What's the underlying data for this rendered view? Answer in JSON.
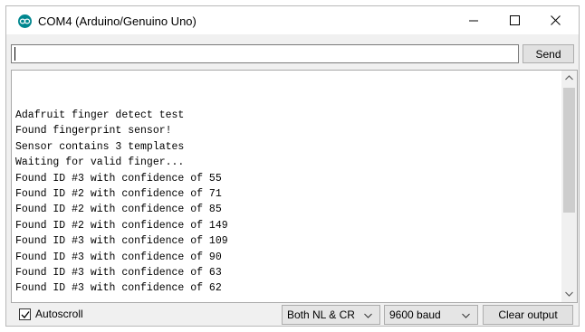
{
  "window": {
    "title": "COM4 (Arduino/Genuino Uno)",
    "icon": "arduino-icon",
    "controls": [
      "minimize-icon",
      "maximize-icon",
      "close-icon"
    ]
  },
  "input": {
    "value": "",
    "send_label": "Send"
  },
  "output": {
    "lines": [
      "Adafruit finger detect test",
      "Found fingerprint sensor!",
      "Sensor contains 3 templates",
      "Waiting for valid finger...",
      "Found ID #3 with confidence of 55",
      "Found ID #2 with confidence of 71",
      "Found ID #2 with confidence of 85",
      "Found ID #2 with confidence of 149",
      "Found ID #3 with confidence of 109",
      "Found ID #3 with confidence of 90",
      "Found ID #3 with confidence of 63",
      "Found ID #3 with confidence of 62"
    ]
  },
  "footer": {
    "autoscroll_label": "Autoscroll",
    "autoscroll_checked": true,
    "line_ending": "Both NL & CR",
    "baud_rate": "9600 baud",
    "clear_label": "Clear output"
  },
  "colors": {
    "arduino_teal": "#00878f",
    "window_bg": "#f0f0f0"
  }
}
